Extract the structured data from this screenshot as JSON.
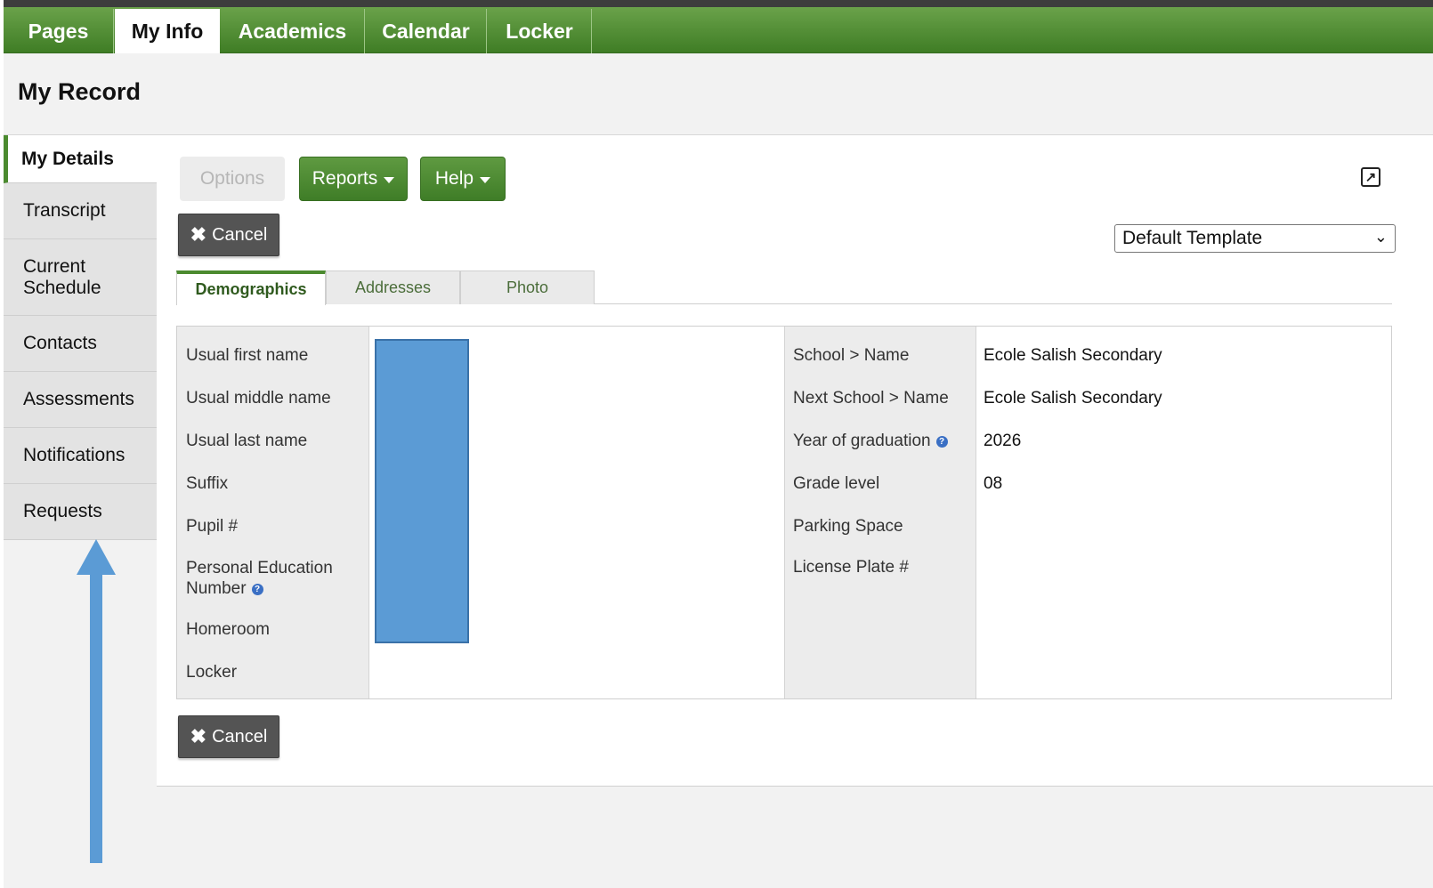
{
  "topnav": {
    "tabs": [
      {
        "label": "Pages"
      },
      {
        "label": "My Info"
      },
      {
        "label": "Academics"
      },
      {
        "label": "Calendar"
      },
      {
        "label": "Locker"
      }
    ],
    "active_tab": "My Info"
  },
  "page": {
    "title": "My Record"
  },
  "sidenav": {
    "items": [
      {
        "label": "My Details"
      },
      {
        "label": "Transcript"
      },
      {
        "label": "Current Schedule"
      },
      {
        "label": "Contacts"
      },
      {
        "label": "Assessments"
      },
      {
        "label": "Notifications"
      },
      {
        "label": "Requests"
      }
    ],
    "active_item": "My Details"
  },
  "toolbar": {
    "options_label": "Options",
    "reports_label": "Reports",
    "help_label": "Help",
    "cancel_label": "Cancel",
    "template_select": "Default Template"
  },
  "subtabs": [
    {
      "label": "Demographics"
    },
    {
      "label": "Addresses"
    },
    {
      "label": "Photo"
    }
  ],
  "active_subtab": "Demographics",
  "details": {
    "left_labels": [
      "Usual first name",
      "Usual middle name",
      "Usual last name",
      "Suffix",
      "Pupil #",
      "Personal Education Number",
      "Homeroom",
      "Locker"
    ],
    "right_fields": [
      {
        "label": "School > Name",
        "value": "Ecole Salish Secondary"
      },
      {
        "label": "Next School > Name",
        "value": "Ecole Salish Secondary"
      },
      {
        "label": "Year of graduation",
        "value": "2026"
      },
      {
        "label": "Grade level",
        "value": "08"
      },
      {
        "label": "Parking Space",
        "value": ""
      },
      {
        "label": "License Plate #",
        "value": ""
      }
    ]
  },
  "colors": {
    "nav_green": "#4b8a2f",
    "redaction_blue": "#5b9bd5",
    "annotation_arrow": "#5b9bd5"
  },
  "icons": [
    "close-icon",
    "caret-down-icon",
    "popout-icon",
    "info-icon",
    "chevron-down-icon"
  ]
}
